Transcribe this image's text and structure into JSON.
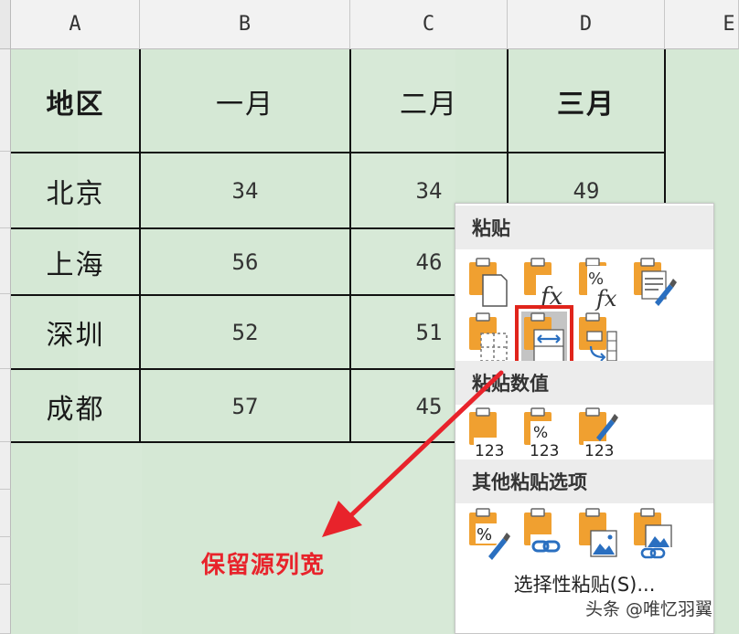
{
  "columns": [
    "A",
    "B",
    "C",
    "D",
    "E"
  ],
  "table": {
    "header": [
      "地区",
      "一月",
      "二月",
      "三月"
    ],
    "rows": [
      [
        "北京",
        "34",
        "34",
        "49"
      ],
      [
        "上海",
        "56",
        "46",
        ""
      ],
      [
        "深圳",
        "52",
        "51",
        ""
      ],
      [
        "成都",
        "57",
        "45",
        ""
      ]
    ]
  },
  "context_menu": {
    "sections": [
      {
        "title": "粘贴",
        "rows": [
          [
            {
              "icon": "paste-icon"
            },
            {
              "icon": "paste-formulas-icon"
            },
            {
              "icon": "paste-formulas-number-format-icon"
            },
            {
              "icon": "paste-keep-source-formatting-icon"
            }
          ],
          [
            {
              "icon": "paste-no-borders-icon"
            },
            {
              "icon": "paste-keep-source-column-widths-icon",
              "selected": true
            },
            {
              "icon": "paste-transpose-icon"
            }
          ]
        ]
      },
      {
        "title": "粘贴数值",
        "rows": [
          [
            {
              "icon": "paste-values-icon",
              "text": "123"
            },
            {
              "icon": "paste-values-number-format-icon",
              "text": "123"
            },
            {
              "icon": "paste-values-source-formatting-icon",
              "text": "123"
            }
          ]
        ]
      },
      {
        "title": "其他粘贴选项",
        "rows": [
          [
            {
              "icon": "paste-formatting-icon"
            },
            {
              "icon": "paste-link-icon"
            },
            {
              "icon": "paste-picture-icon"
            },
            {
              "icon": "paste-linked-picture-icon"
            }
          ]
        ]
      }
    ],
    "paste_special_label": "选择性粘贴(S)..."
  },
  "annotation": {
    "text": "保留源列宽",
    "color": "#e8232b"
  },
  "watermark": "头条 @唯忆羽翼",
  "colors": {
    "sheet_bg": "#d5e8d5",
    "highlight": "#e0241b",
    "icon_orange": "#f0a030",
    "icon_blue": "#2a6fc0"
  }
}
